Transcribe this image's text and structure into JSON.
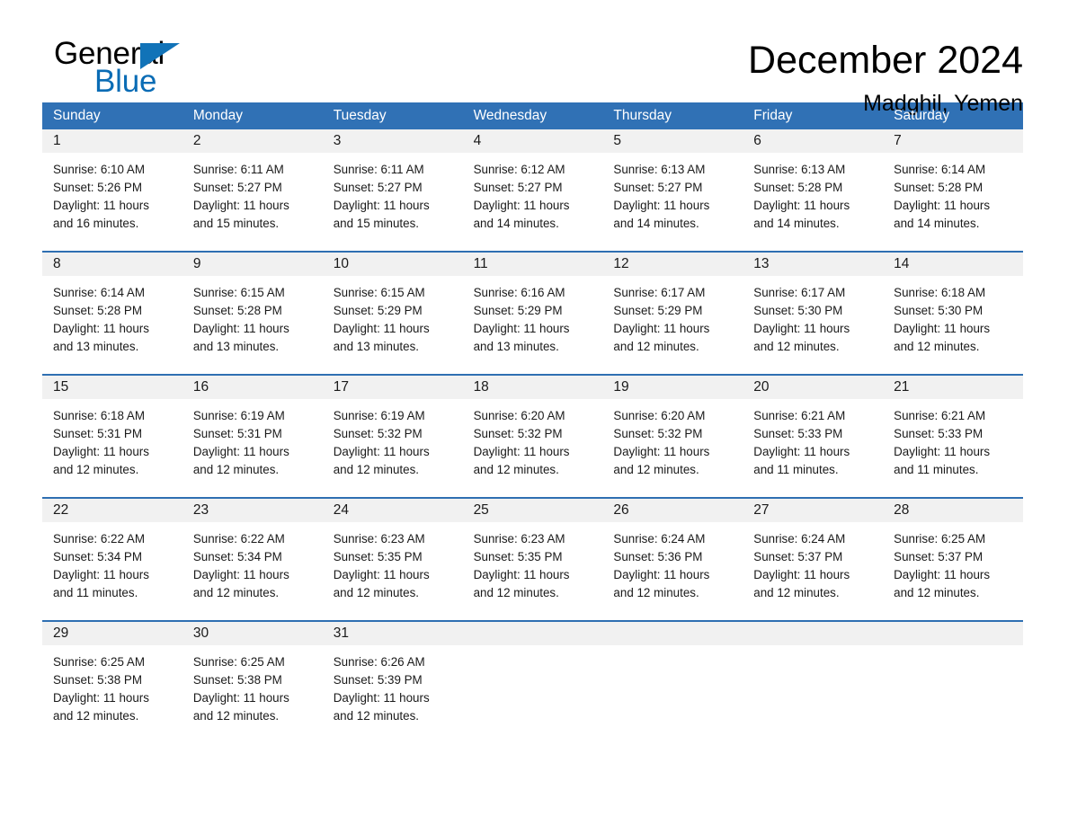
{
  "brand": {
    "name_part1": "General",
    "name_part2": "Blue",
    "triangle_color": "#1173b8",
    "blue_color": "#0a6cb5"
  },
  "header": {
    "month_title": "December 2024",
    "location": "Madghil, Yemen"
  },
  "theme": {
    "header_blue": "#3071b5",
    "divider_blue": "#2f6fb2",
    "date_band_gray": "#f1f1f1"
  },
  "weekday_headers": [
    "Sunday",
    "Monday",
    "Tuesday",
    "Wednesday",
    "Thursday",
    "Friday",
    "Saturday"
  ],
  "weeks": [
    {
      "days": [
        {
          "date": "1",
          "sunrise": "Sunrise: 6:10 AM",
          "sunset": "Sunset: 5:26 PM",
          "daylight_line1": "Daylight: 11 hours",
          "daylight_line2": "and 16 minutes."
        },
        {
          "date": "2",
          "sunrise": "Sunrise: 6:11 AM",
          "sunset": "Sunset: 5:27 PM",
          "daylight_line1": "Daylight: 11 hours",
          "daylight_line2": "and 15 minutes."
        },
        {
          "date": "3",
          "sunrise": "Sunrise: 6:11 AM",
          "sunset": "Sunset: 5:27 PM",
          "daylight_line1": "Daylight: 11 hours",
          "daylight_line2": "and 15 minutes."
        },
        {
          "date": "4",
          "sunrise": "Sunrise: 6:12 AM",
          "sunset": "Sunset: 5:27 PM",
          "daylight_line1": "Daylight: 11 hours",
          "daylight_line2": "and 14 minutes."
        },
        {
          "date": "5",
          "sunrise": "Sunrise: 6:13 AM",
          "sunset": "Sunset: 5:27 PM",
          "daylight_line1": "Daylight: 11 hours",
          "daylight_line2": "and 14 minutes."
        },
        {
          "date": "6",
          "sunrise": "Sunrise: 6:13 AM",
          "sunset": "Sunset: 5:28 PM",
          "daylight_line1": "Daylight: 11 hours",
          "daylight_line2": "and 14 minutes."
        },
        {
          "date": "7",
          "sunrise": "Sunrise: 6:14 AM",
          "sunset": "Sunset: 5:28 PM",
          "daylight_line1": "Daylight: 11 hours",
          "daylight_line2": "and 14 minutes."
        }
      ]
    },
    {
      "days": [
        {
          "date": "8",
          "sunrise": "Sunrise: 6:14 AM",
          "sunset": "Sunset: 5:28 PM",
          "daylight_line1": "Daylight: 11 hours",
          "daylight_line2": "and 13 minutes."
        },
        {
          "date": "9",
          "sunrise": "Sunrise: 6:15 AM",
          "sunset": "Sunset: 5:28 PM",
          "daylight_line1": "Daylight: 11 hours",
          "daylight_line2": "and 13 minutes."
        },
        {
          "date": "10",
          "sunrise": "Sunrise: 6:15 AM",
          "sunset": "Sunset: 5:29 PM",
          "daylight_line1": "Daylight: 11 hours",
          "daylight_line2": "and 13 minutes."
        },
        {
          "date": "11",
          "sunrise": "Sunrise: 6:16 AM",
          "sunset": "Sunset: 5:29 PM",
          "daylight_line1": "Daylight: 11 hours",
          "daylight_line2": "and 13 minutes."
        },
        {
          "date": "12",
          "sunrise": "Sunrise: 6:17 AM",
          "sunset": "Sunset: 5:29 PM",
          "daylight_line1": "Daylight: 11 hours",
          "daylight_line2": "and 12 minutes."
        },
        {
          "date": "13",
          "sunrise": "Sunrise: 6:17 AM",
          "sunset": "Sunset: 5:30 PM",
          "daylight_line1": "Daylight: 11 hours",
          "daylight_line2": "and 12 minutes."
        },
        {
          "date": "14",
          "sunrise": "Sunrise: 6:18 AM",
          "sunset": "Sunset: 5:30 PM",
          "daylight_line1": "Daylight: 11 hours",
          "daylight_line2": "and 12 minutes."
        }
      ]
    },
    {
      "days": [
        {
          "date": "15",
          "sunrise": "Sunrise: 6:18 AM",
          "sunset": "Sunset: 5:31 PM",
          "daylight_line1": "Daylight: 11 hours",
          "daylight_line2": "and 12 minutes."
        },
        {
          "date": "16",
          "sunrise": "Sunrise: 6:19 AM",
          "sunset": "Sunset: 5:31 PM",
          "daylight_line1": "Daylight: 11 hours",
          "daylight_line2": "and 12 minutes."
        },
        {
          "date": "17",
          "sunrise": "Sunrise: 6:19 AM",
          "sunset": "Sunset: 5:32 PM",
          "daylight_line1": "Daylight: 11 hours",
          "daylight_line2": "and 12 minutes."
        },
        {
          "date": "18",
          "sunrise": "Sunrise: 6:20 AM",
          "sunset": "Sunset: 5:32 PM",
          "daylight_line1": "Daylight: 11 hours",
          "daylight_line2": "and 12 minutes."
        },
        {
          "date": "19",
          "sunrise": "Sunrise: 6:20 AM",
          "sunset": "Sunset: 5:32 PM",
          "daylight_line1": "Daylight: 11 hours",
          "daylight_line2": "and 12 minutes."
        },
        {
          "date": "20",
          "sunrise": "Sunrise: 6:21 AM",
          "sunset": "Sunset: 5:33 PM",
          "daylight_line1": "Daylight: 11 hours",
          "daylight_line2": "and 11 minutes."
        },
        {
          "date": "21",
          "sunrise": "Sunrise: 6:21 AM",
          "sunset": "Sunset: 5:33 PM",
          "daylight_line1": "Daylight: 11 hours",
          "daylight_line2": "and 11 minutes."
        }
      ]
    },
    {
      "days": [
        {
          "date": "22",
          "sunrise": "Sunrise: 6:22 AM",
          "sunset": "Sunset: 5:34 PM",
          "daylight_line1": "Daylight: 11 hours",
          "daylight_line2": "and 11 minutes."
        },
        {
          "date": "23",
          "sunrise": "Sunrise: 6:22 AM",
          "sunset": "Sunset: 5:34 PM",
          "daylight_line1": "Daylight: 11 hours",
          "daylight_line2": "and 12 minutes."
        },
        {
          "date": "24",
          "sunrise": "Sunrise: 6:23 AM",
          "sunset": "Sunset: 5:35 PM",
          "daylight_line1": "Daylight: 11 hours",
          "daylight_line2": "and 12 minutes."
        },
        {
          "date": "25",
          "sunrise": "Sunrise: 6:23 AM",
          "sunset": "Sunset: 5:35 PM",
          "daylight_line1": "Daylight: 11 hours",
          "daylight_line2": "and 12 minutes."
        },
        {
          "date": "26",
          "sunrise": "Sunrise: 6:24 AM",
          "sunset": "Sunset: 5:36 PM",
          "daylight_line1": "Daylight: 11 hours",
          "daylight_line2": "and 12 minutes."
        },
        {
          "date": "27",
          "sunrise": "Sunrise: 6:24 AM",
          "sunset": "Sunset: 5:37 PM",
          "daylight_line1": "Daylight: 11 hours",
          "daylight_line2": "and 12 minutes."
        },
        {
          "date": "28",
          "sunrise": "Sunrise: 6:25 AM",
          "sunset": "Sunset: 5:37 PM",
          "daylight_line1": "Daylight: 11 hours",
          "daylight_line2": "and 12 minutes."
        }
      ]
    },
    {
      "days": [
        {
          "date": "29",
          "sunrise": "Sunrise: 6:25 AM",
          "sunset": "Sunset: 5:38 PM",
          "daylight_line1": "Daylight: 11 hours",
          "daylight_line2": "and 12 minutes."
        },
        {
          "date": "30",
          "sunrise": "Sunrise: 6:25 AM",
          "sunset": "Sunset: 5:38 PM",
          "daylight_line1": "Daylight: 11 hours",
          "daylight_line2": "and 12 minutes."
        },
        {
          "date": "31",
          "sunrise": "Sunrise: 6:26 AM",
          "sunset": "Sunset: 5:39 PM",
          "daylight_line1": "Daylight: 11 hours",
          "daylight_line2": "and 12 minutes."
        },
        {
          "date": "",
          "sunrise": "",
          "sunset": "",
          "daylight_line1": "",
          "daylight_line2": ""
        },
        {
          "date": "",
          "sunrise": "",
          "sunset": "",
          "daylight_line1": "",
          "daylight_line2": ""
        },
        {
          "date": "",
          "sunrise": "",
          "sunset": "",
          "daylight_line1": "",
          "daylight_line2": ""
        },
        {
          "date": "",
          "sunrise": "",
          "sunset": "",
          "daylight_line1": "",
          "daylight_line2": ""
        }
      ]
    }
  ]
}
